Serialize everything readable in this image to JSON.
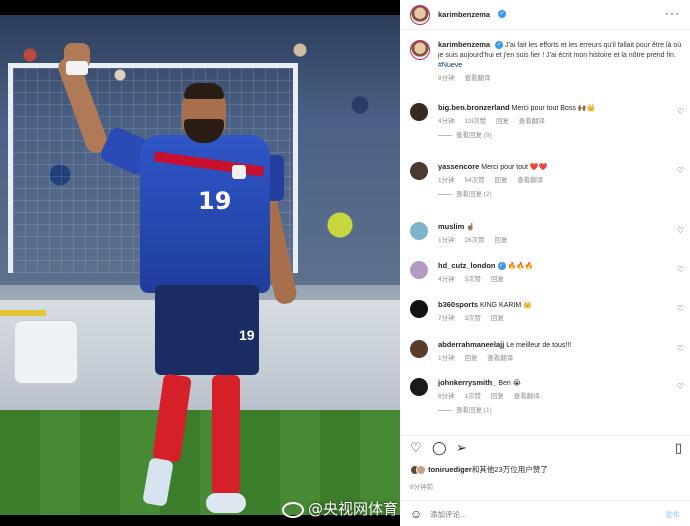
{
  "post": {
    "username": "karimbenzema",
    "caption": "J'ai fait les efforts et les erreurs qu'il fallait pour être là où je suis aujourd'hui et j'en suis fier ! J'ai écrit mon histoire et la nôtre prend fin.",
    "hashtag": "#Nueve",
    "time": "8分钟",
    "translate": "查看翻译",
    "jersey_number": "19",
    "shorts_number": "19"
  },
  "comments": [
    {
      "username": "big.ben.bronzerland",
      "text": "Merci pour tout Boss 🙌🏾👑",
      "time": "4分钟",
      "likes": "19l次赞",
      "reply": "回复",
      "translate": "查看翻译",
      "view_replies": "查看回复 (9)",
      "avatar_color": "#3a2a1e"
    },
    {
      "username": "yassencore",
      "text": "Merci pour tout ❤️❤️",
      "time": "1分钟",
      "likes": "54次赞",
      "reply": "回复",
      "translate": "查看翻译",
      "view_replies": "查看回复 (2)",
      "avatar_color": "#4a3a30"
    },
    {
      "username": "muslim",
      "text": "☝🏽",
      "time": "1分钟",
      "likes": "26次赞",
      "reply": "回复",
      "avatar_color": "#7fb4c9"
    },
    {
      "username": "hd_cutz_london",
      "text": "🔥🔥🔥",
      "time": "4分钟",
      "likes": "3次赞",
      "reply": "回复",
      "avatar_color": "#b59bc1"
    },
    {
      "username": "b360sports",
      "text": "KING KARIM 👑",
      "time": "7分钟",
      "likes": "3次赞",
      "reply": "回复",
      "avatar_color": "#111111"
    },
    {
      "username": "abderrahmaneelajj",
      "text": "Le meilleur de tous!!!",
      "time": "1分钟",
      "likes": "",
      "reply": "回复",
      "translate": "查看翻译",
      "avatar_color": "#5a3b2a"
    },
    {
      "username": "johnkerrysmith_",
      "text": "Ben 😭",
      "time": "6分钟",
      "likes": "1次赞",
      "reply": "回复",
      "translate": "查看翻译",
      "view_replies": "查看回复 (1)",
      "avatar_color": "#1a1a1a"
    }
  ],
  "likes_line": {
    "user": "toniruediger",
    "rest": "和其他23万位用户赞了"
  },
  "post_time": "8分钟前",
  "comment_input": {
    "placeholder": "添加评论...",
    "post_label": "发布"
  },
  "watermark": "@央视网体育",
  "icons": {
    "more": "more-icon",
    "heart": "heart-icon",
    "comment": "comment-icon",
    "share": "share-icon",
    "save": "bookmark-icon",
    "emoji": "emoji-icon",
    "verified": "verified-badge-icon"
  },
  "colors": {
    "verified": "#3897f0",
    "hashtag": "#00376b",
    "meta": "#8e8e8e"
  }
}
